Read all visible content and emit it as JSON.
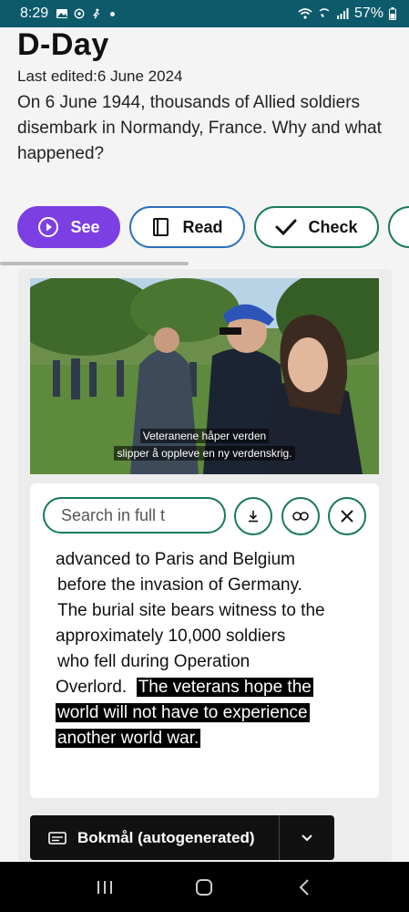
{
  "status": {
    "time": "8:29",
    "battery": "57%"
  },
  "article": {
    "title": "D-Day",
    "edited": "Last edited:6 June 2024",
    "intro": "On 6 June 1944, thousands of Allied soldiers disembark in Normandy, France. Why and what happened?"
  },
  "modes": {
    "see": "See",
    "read": "Read",
    "check": "Check"
  },
  "video": {
    "subtitle_line1": "Veteranene håper verden",
    "subtitle_line2": "slipper å oppleve en ny verdenskrig."
  },
  "transcript": {
    "search_placeholder": "Search in full t",
    "line1": "advanced to Paris and Belgium",
    "line2": "before the invasion of Germany.",
    "line3": "The burial site bears witness to the",
    "line4": "approximately 10,000 soldiers",
    "line5": "who fell during Operation",
    "line6_plain": "Overlord.",
    "line6_hl": "The veterans hope the",
    "line7_hl": "world will not have to experience",
    "line8_hl": "another world war."
  },
  "language": {
    "label": "Bokmål (autogenerated)"
  },
  "colors": {
    "status_bar": "#0d5a6b",
    "see_accent": "#7b3fe4",
    "read_accent": "#2a6fbf",
    "check_accent": "#177a5e"
  }
}
